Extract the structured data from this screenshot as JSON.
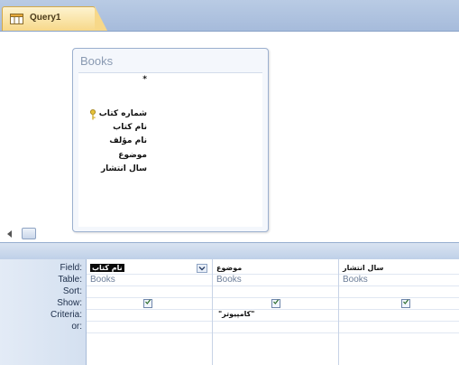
{
  "tab": {
    "label": "Query1",
    "icon": "query-icon"
  },
  "table_window": {
    "title": "Books",
    "fields": [
      {
        "label": "*",
        "primary_key": false
      },
      {
        "label": "شماره كتاب",
        "primary_key": true
      },
      {
        "label": "نام كتاب",
        "primary_key": false
      },
      {
        "label": "نام مؤلف",
        "primary_key": false
      },
      {
        "label": "موضوع",
        "primary_key": false
      },
      {
        "label": "سال انتشار",
        "primary_key": false
      }
    ]
  },
  "grid": {
    "row_labels": [
      "Field:",
      "Table:",
      "Sort:",
      "Show:",
      "Criteria:",
      "or:"
    ],
    "columns": [
      {
        "field": "نام كتاب",
        "table": "Books",
        "sort": "",
        "show": true,
        "criteria": "",
        "or": "",
        "selected": true
      },
      {
        "field": "موضوع",
        "table": "Books",
        "sort": "",
        "show": true,
        "criteria": "\"كامپيوتر\"",
        "or": "",
        "selected": false
      },
      {
        "field": "سال انتشار",
        "table": "Books",
        "sort": "",
        "show": true,
        "criteria": "",
        "or": "",
        "selected": false
      }
    ]
  },
  "colors": {
    "tab_fill": "#f7d889",
    "header_fill": "#b9cbe4",
    "grid_label_fill": "#d4e0f0"
  }
}
